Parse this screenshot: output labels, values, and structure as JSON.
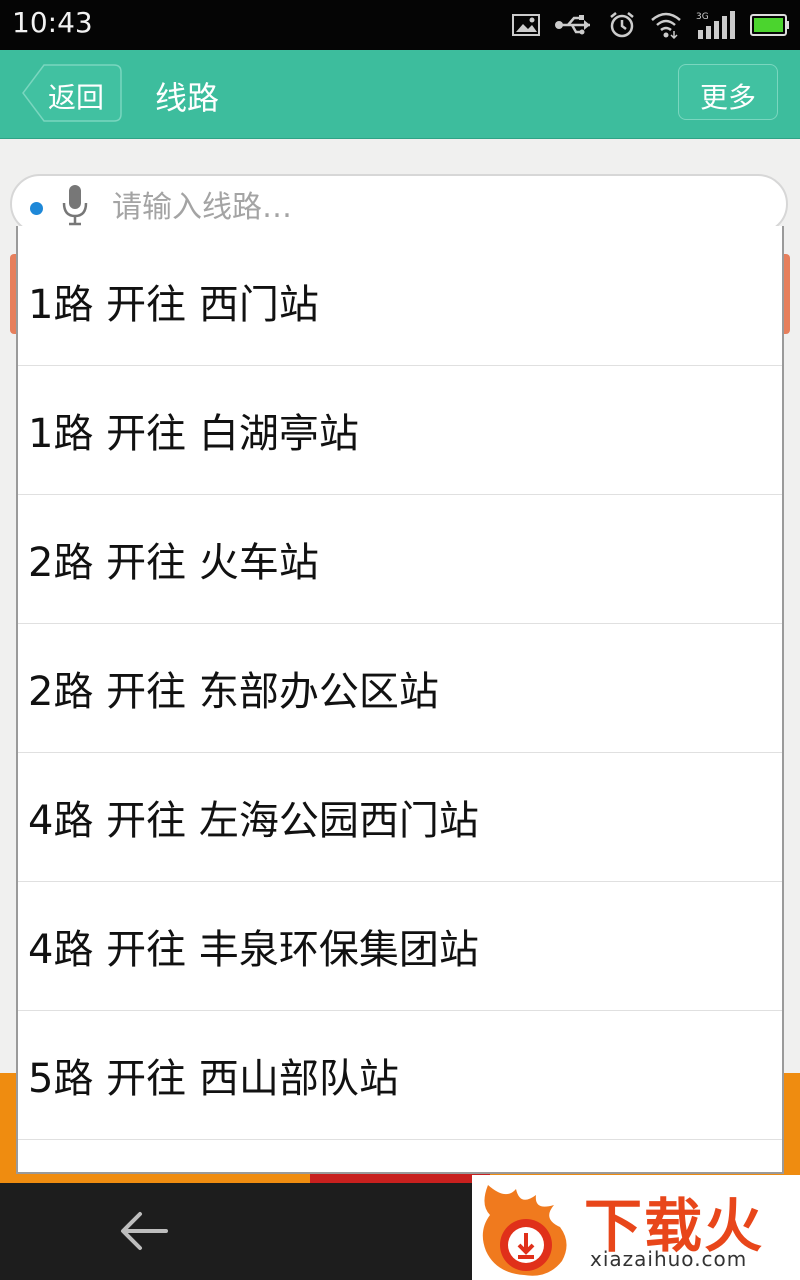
{
  "status_bar": {
    "time": "10:43",
    "icons": [
      "image-icon",
      "usb-icon",
      "alarm-icon",
      "wifi-icon",
      "3g-signal-icon",
      "battery-icon"
    ],
    "network": "3G"
  },
  "header": {
    "back_label": "返回",
    "title": "线路",
    "more_label": "更多",
    "color": "#3dbd9d"
  },
  "search": {
    "placeholder": "请输入线路…",
    "value": ""
  },
  "routes": [
    {
      "label": "1路 开往 西门站"
    },
    {
      "label": "1路 开往 白湖亭站"
    },
    {
      "label": "2路 开往 火车站"
    },
    {
      "label": "2路 开往 东部办公区站"
    },
    {
      "label": "4路 开往 左海公园西门站"
    },
    {
      "label": "4路 开往 丰泉环保集团站"
    },
    {
      "label": "5路 开往 西山部队站"
    },
    {
      "label": ""
    }
  ],
  "watermark": {
    "title": "下载火",
    "url": "xiazaihuo.com"
  }
}
